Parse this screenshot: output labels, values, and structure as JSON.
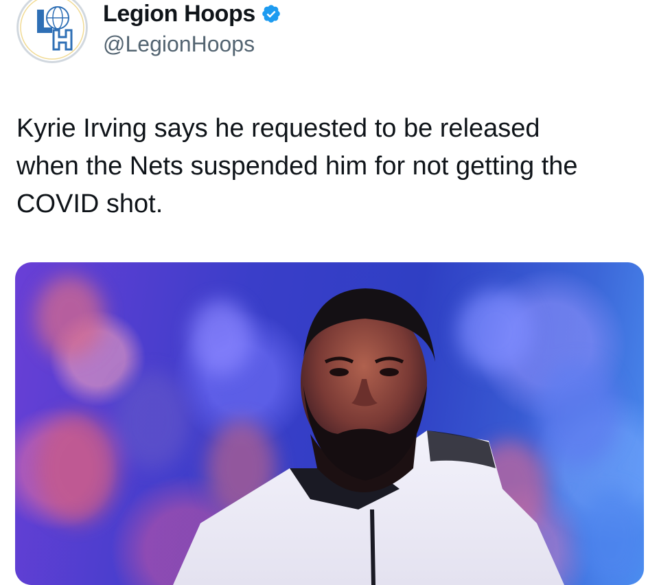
{
  "tweet": {
    "author": {
      "display_name": "Legion Hoops",
      "handle": "@LegionHoops",
      "verified": true,
      "verified_icon": "verified-badge-icon",
      "avatar_initials": "LH"
    },
    "text": "Kyrie Irving says he requested to be released\nwhen the Nets suspended him for not getting the\nCOVID shot.",
    "media": {
      "type": "photo",
      "alt": ""
    }
  },
  "colors": {
    "text_primary": "#0f1419",
    "text_secondary": "#536471",
    "verified_blue": "#1d9bf0"
  }
}
